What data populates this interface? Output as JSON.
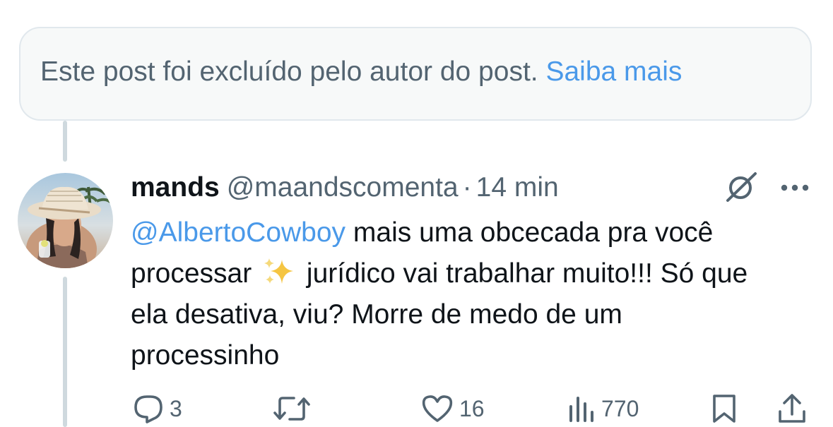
{
  "deleted_notice": {
    "text": "Este post foi excluído pelo autor do post.",
    "link": "Saiba mais"
  },
  "tweet": {
    "display_name": "mands",
    "handle": "@maandscomenta",
    "separator": "·",
    "time": "14 min",
    "mention": "@AlbertoCowboy",
    "text_part1": " mais uma obcecada pra você processar ",
    "emoji": "sparkles-emoji",
    "text_part2": " jurídico vai trabalhar muito!!! Só que ela desativa, viu? Morre de medo de um processinho"
  },
  "actions": {
    "replies": "3",
    "likes": "16",
    "views": "770"
  },
  "icons": [
    "grok-icon",
    "more-icon",
    "reply-icon",
    "repost-icon",
    "like-icon",
    "views-icon",
    "bookmark-icon",
    "share-icon"
  ],
  "colors": {
    "link": "#4a99e9",
    "secondary_text": "#536471",
    "primary_text": "#0f1419",
    "notice_bg": "#f7f9f9",
    "thread_line": "#cfd9de"
  }
}
